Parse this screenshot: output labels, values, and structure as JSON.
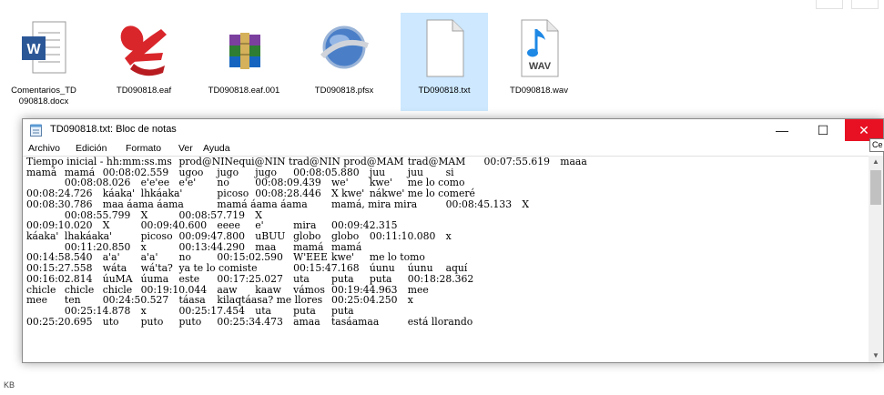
{
  "files": [
    {
      "name": "Comentarios_TD\n090818.docx",
      "icon": "word-document-icon"
    },
    {
      "name": "TD090818.eaf",
      "icon": "elan-icon"
    },
    {
      "name": "TD090818.eaf.001",
      "icon": "winrar-archive-icon"
    },
    {
      "name": "TD090818.pfsx",
      "icon": "pfsx-globe-icon"
    },
    {
      "name": "TD090818.txt",
      "icon": "text-file-icon",
      "selected": true
    },
    {
      "name": "TD090818.wav",
      "icon": "wav-audio-icon"
    }
  ],
  "wav_badge": "WAV",
  "word_badge": "W",
  "notepad": {
    "title": "TD090818.txt: Bloc de notas",
    "menu": [
      "Archivo",
      "Edición",
      "Formato",
      "Ver",
      "Ayuda"
    ],
    "minimize": "—",
    "maximize": "☐",
    "close": "✕",
    "content": "Tiempo inicial - hh:mm:ss.ms\tprod@NINequi@NIN trad@NIN prod@MAM\ttrad@MAM\t00:07:55.619\tmaaa\nmamá\tmamá\t00:08:02.559\tugoo\tjugo\tjugo\t00:08:05.880\tjuu\tjuu\tsi\n\t00:08:08.026\te'e'ee\te'e'\tno\t00:08:09.439\twe'\tkwe'\tme lo como\n00:08:24.726\tkáaka'\tlhkáaka'\tpicoso\t00:08:28.446\tX kwe'\tnákwe'\tme lo comeré\n00:08:30.786\tmaa áama áama\tmamá áama áama\tmamá, mira mira\t00:08:45.133\tX\n\t00:08:55.799\tX\t00:08:57.719\tX\n00:09:10.020\tX\t00:09:40.600\teeee\te'\tmira\t00:09:42.315\nkáaka'\tlhakáaka'\tpicoso\t00:09:47.800\tuBUU\tglobo\tglobo\t00:11:10.080\tx\n\t00:11:20.850\tx\t00:13:44.290\tmaa\tmamá\tmamá\n00:14:58.540\ta'a'\ta'a'\tno\t00:15:02.590\tW'EEE\tkwe'\tme lo tomo\n00:15:27.558\twáta\twá'ta?\tya te lo comiste\t00:15:47.168\túunu\túunu\taquí\n00:16:02.814\túuMA\túuma\teste\t00:17:25.027\tuta\tputa\tputa\t00:18:28.362\nchicle\tchicle\tchicle\t00:19:10.044\taaw\tkaaw\tvámos\t00:19:44.963\tmee\nmee\tten\t00:24:50.527\ttáasa\tkilaqtáasa? me llores\t00:25:04.250\tx\n\t00:25:14.878\tx\t00:25:17.454\tuta\tputa\tputa\n00:25:20.695\tuto\tputo\tputo\t00:25:34.473\tamaa\ttasáamaa\testá llorando"
  },
  "tooltip": "Ce",
  "status": "KB"
}
